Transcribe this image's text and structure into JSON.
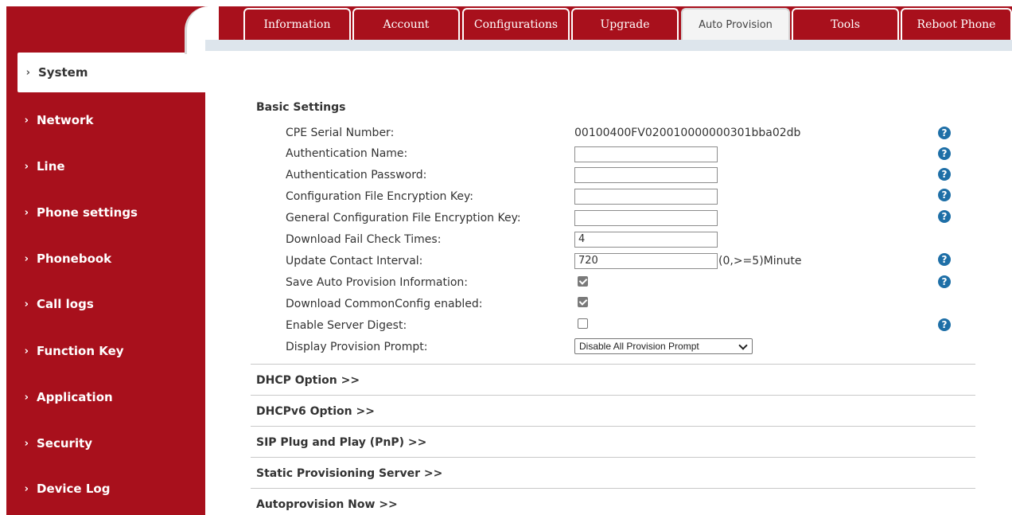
{
  "tabs": [
    {
      "label": "Information"
    },
    {
      "label": "Account"
    },
    {
      "label": "Configurations"
    },
    {
      "label": "Upgrade"
    },
    {
      "label": "Auto Provision",
      "active": true
    },
    {
      "label": "Tools"
    },
    {
      "label": "Reboot Phone"
    }
  ],
  "sidebar": {
    "chevron": "›",
    "items": [
      {
        "label": "System",
        "active": true
      },
      {
        "label": "Network"
      },
      {
        "label": "Line"
      },
      {
        "label": "Phone settings"
      },
      {
        "label": "Phonebook"
      },
      {
        "label": "Call logs"
      },
      {
        "label": "Function Key"
      },
      {
        "label": "Application"
      },
      {
        "label": "Security"
      },
      {
        "label": "Device Log"
      }
    ]
  },
  "basic_settings": {
    "title": "Basic Settings",
    "cpe_serial": {
      "label": "CPE Serial Number:",
      "value": "00100400FV020010000000301bba02db"
    },
    "auth_name": {
      "label": "Authentication Name:",
      "value": ""
    },
    "auth_password": {
      "label": "Authentication Password:",
      "value": ""
    },
    "cfg_enc_key": {
      "label": "Configuration File Encryption Key:",
      "value": ""
    },
    "gen_cfg_enc_key": {
      "label": "General Configuration File Encryption Key:",
      "value": ""
    },
    "download_fail": {
      "label": "Download Fail Check Times:",
      "value": "4"
    },
    "update_interval": {
      "label": "Update Contact Interval:",
      "value": "720",
      "unit": "(0,>=5)Minute"
    },
    "save_auto_prov": {
      "label": "Save Auto Provision Information:",
      "checked": true
    },
    "download_common": {
      "label": "Download CommonConfig enabled:",
      "checked": true
    },
    "server_digest": {
      "label": "Enable Server Digest:",
      "checked": false
    },
    "display_prompt": {
      "label": "Display Provision Prompt:",
      "selected": "Disable All Provision Prompt"
    }
  },
  "collapsed_sections": [
    "DHCP Option >>",
    "DHCPv6 Option >>",
    "SIP Plug and Play (PnP) >>",
    "Static Provisioning Server >>",
    "Autoprovision Now >>"
  ],
  "help_glyph": "?",
  "colors": {
    "brand_red": "#a8101c",
    "help_blue": "#1e6fa7"
  }
}
